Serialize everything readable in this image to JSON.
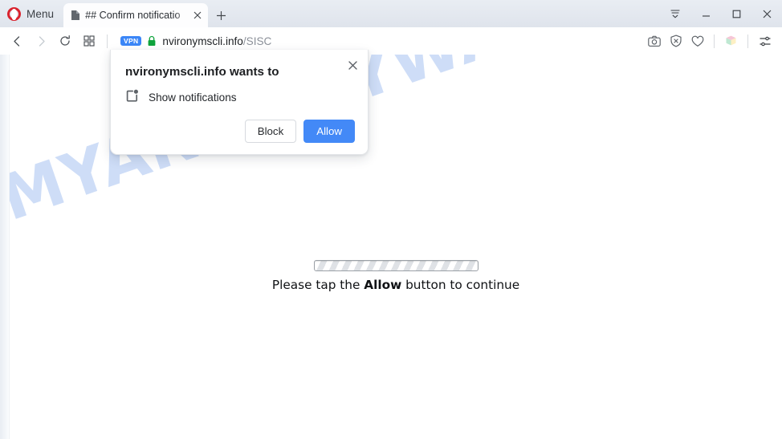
{
  "window": {
    "menu_label": "Menu",
    "controls": {
      "tablist_icon": "tab-list-dropdown-icon",
      "minimize_icon": "minimize-icon",
      "maximize_icon": "maximize-icon",
      "close_icon": "close-icon"
    }
  },
  "tabs": {
    "active": {
      "title": "## Confirm notificatio",
      "favicon_icon": "page-document-icon",
      "close_icon": "tab-close-icon"
    },
    "new_tab_icon": "plus-icon"
  },
  "toolbar": {
    "back_icon": "chevron-left-icon",
    "forward_icon": "chevron-right-icon",
    "reload_icon": "reload-icon",
    "speeddial_icon": "grid-squares-icon",
    "address": {
      "vpn_badge": "VPN",
      "lock_icon": "padlock-icon",
      "host": "nvironymscli.info",
      "path": "/SISC"
    },
    "right_icons": [
      {
        "name": "camera-snapshot-icon"
      },
      {
        "name": "shield-adblock-icon"
      },
      {
        "name": "heart-favorite-icon"
      },
      {
        "name": "cube-workspaces-icon"
      },
      {
        "name": "easy-setup-sliders-icon"
      }
    ]
  },
  "permission_dialog": {
    "title": "nvironymscli.info wants to",
    "permission_icon": "show-notifications-icon",
    "permission_label": "Show notifications",
    "block_label": "Block",
    "allow_label": "Allow",
    "close_icon": "dialog-close-icon"
  },
  "page": {
    "watermark": "MYANTISPYWARE.COM",
    "progress_name": "loading-progress-bar",
    "tagline_prefix": "Please tap the ",
    "tagline_emphasis": "Allow",
    "tagline_suffix": " button to continue"
  },
  "colors": {
    "accent_blue": "#4389f7",
    "opera_red": "#d9232e",
    "lock_green": "#0fa33c",
    "watermark_blue": "#ccdcf7"
  }
}
